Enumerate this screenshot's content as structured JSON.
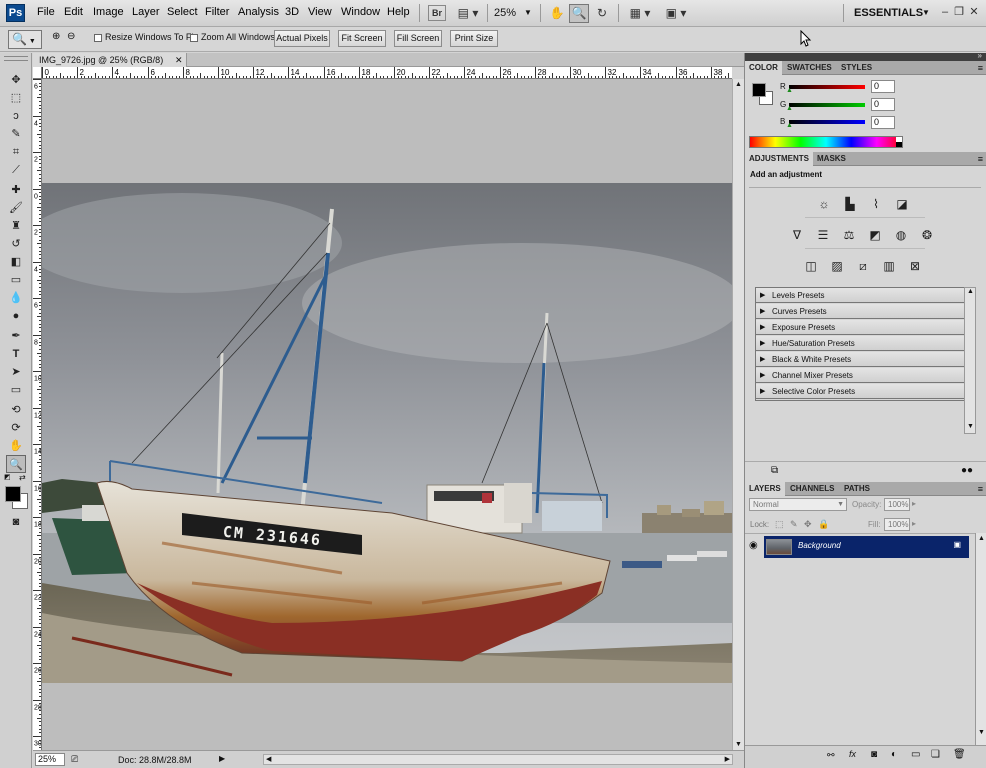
{
  "app": {
    "logo": "Ps"
  },
  "menu": {
    "items": [
      "File",
      "Edit",
      "Image",
      "Layer",
      "Select",
      "Filter",
      "Analysis",
      "3D",
      "View",
      "Window",
      "Help"
    ]
  },
  "appbar": {
    "bridge_label": "Br",
    "zoom": "25%",
    "workspace": "ESSENTIALS"
  },
  "options_bar": {
    "resize_windows_label": "Resize Windows To Fit",
    "zoom_all_label": "Zoom All Windows",
    "buttons": [
      "Actual Pixels",
      "Fit Screen",
      "Fill Screen",
      "Print Size"
    ]
  },
  "document": {
    "tab_title": "IMG_9726.jpg @ 25% (RGB/8)",
    "ruler_h_labels": [
      "0",
      "2",
      "4",
      "6",
      "8",
      "10",
      "12",
      "14",
      "16",
      "18",
      "20",
      "22",
      "24",
      "26",
      "28",
      "30",
      "32",
      "34",
      "36",
      "38",
      "40"
    ],
    "ruler_v_labels": [
      "6",
      "4",
      "2",
      "0",
      "2",
      "4",
      "6",
      "8",
      "10",
      "12",
      "14",
      "16",
      "18",
      "20",
      "22",
      "24",
      "26",
      "28",
      "30"
    ],
    "hull_text": "CM 231646",
    "status_zoom": "25%",
    "status_doc": "Doc: 28.8M/28.8M"
  },
  "color_panel": {
    "tabs": [
      "COLOR",
      "SWATCHES",
      "STYLES"
    ],
    "channels": [
      {
        "label": "R",
        "value": "0",
        "color": "#cc0000"
      },
      {
        "label": "G",
        "value": "0",
        "color": "#00aa00"
      },
      {
        "label": "B",
        "value": "0",
        "color": "#0000cc"
      }
    ]
  },
  "adjustments_panel": {
    "tabs": [
      "ADJUSTMENTS",
      "MASKS"
    ],
    "heading": "Add an adjustment",
    "icon_rows": [
      [
        "brightness-contrast-icon",
        "levels-icon",
        "curves-icon",
        "exposure-icon"
      ],
      [
        "vibrance-icon",
        "hue-saturation-icon",
        "color-balance-icon",
        "black-white-icon",
        "photo-filter-icon",
        "channel-mixer-icon"
      ],
      [
        "invert-icon",
        "posterize-icon",
        "threshold-icon",
        "gradient-map-icon",
        "selective-color-icon"
      ]
    ],
    "presets": [
      "Levels Presets",
      "Curves Presets",
      "Exposure Presets",
      "Hue/Saturation Presets",
      "Black & White Presets",
      "Channel Mixer Presets",
      "Selective Color Presets"
    ]
  },
  "layers_panel": {
    "tabs": [
      "LAYERS",
      "CHANNELS",
      "PATHS"
    ],
    "blend_mode": "Normal",
    "opacity_label": "Opacity:",
    "opacity_value": "100%",
    "lock_label": "Lock:",
    "fill_label": "Fill:",
    "fill_value": "100%",
    "layers": [
      {
        "name": "Background"
      }
    ]
  }
}
